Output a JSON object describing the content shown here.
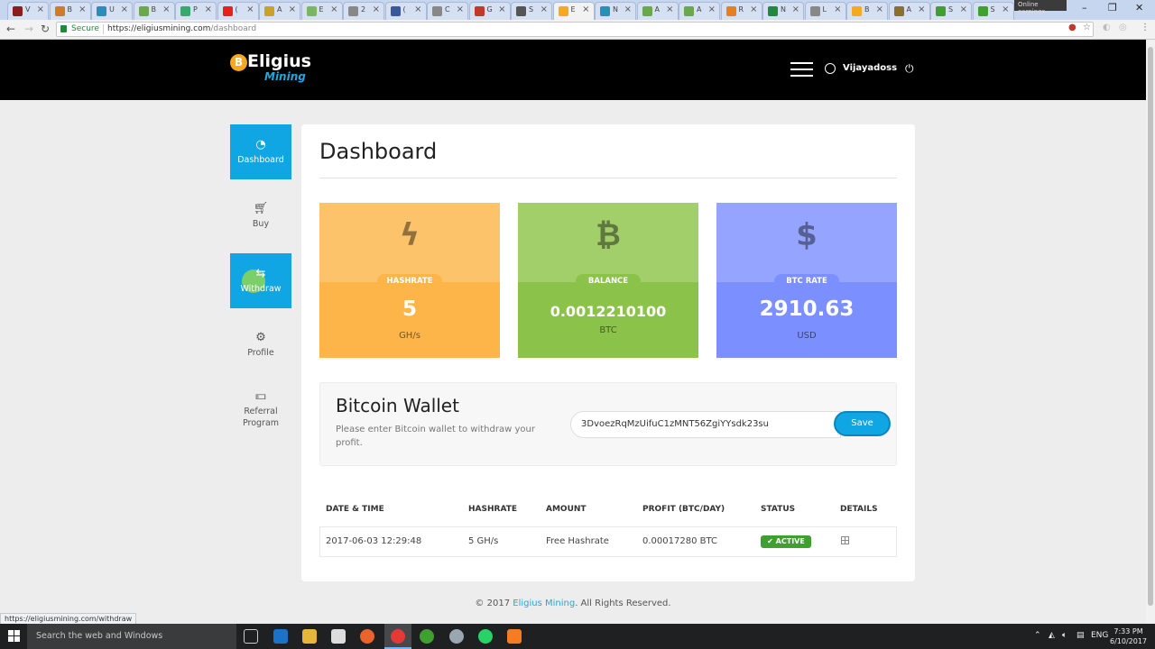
{
  "browser": {
    "tabs": [
      {
        "title": "V",
        "color": "#8b1d1d"
      },
      {
        "title": "B",
        "color": "#d07b2a"
      },
      {
        "title": "U",
        "color": "#2a8fb7"
      },
      {
        "title": "B",
        "color": "#6aa84f"
      },
      {
        "title": "P",
        "color": "#3aa76d"
      },
      {
        "title": "(",
        "color": "#e62117"
      },
      {
        "title": "A",
        "color": "#c9a227"
      },
      {
        "title": "E",
        "color": "#7bb661"
      },
      {
        "title": "2",
        "color": "#888888"
      },
      {
        "title": "(",
        "color": "#3b5998"
      },
      {
        "title": "C",
        "color": "#888888"
      },
      {
        "title": "G",
        "color": "#c0392b"
      },
      {
        "title": "S",
        "color": "#555555"
      },
      {
        "title": "E",
        "color": "#f6a821"
      },
      {
        "title": "N",
        "color": "#2a8fb7"
      },
      {
        "title": "A",
        "color": "#6aa84f"
      },
      {
        "title": "A",
        "color": "#6aa84f"
      },
      {
        "title": "R",
        "color": "#e67e22"
      },
      {
        "title": "N",
        "color": "#1e8a3c"
      },
      {
        "title": "L",
        "color": "#888888"
      },
      {
        "title": "B",
        "color": "#f6a821"
      },
      {
        "title": "A",
        "color": "#8b6f2f"
      },
      {
        "title": "S",
        "color": "#3fa02f"
      },
      {
        "title": "S",
        "color": "#3fa02f"
      }
    ],
    "profile_label": "Online earnings",
    "secure_label": "Secure",
    "url_base": "https://eligiusmining.com",
    "url_path": "/dashboard",
    "status_url": "https://eligiusmining.com/withdraw"
  },
  "header": {
    "logo_coin": "B",
    "logo_main": "Eligius",
    "logo_sub": "Mining",
    "username": "Vijayadoss"
  },
  "sidebar": {
    "items": [
      {
        "label": "Dashboard",
        "icon": "dashboard-icon"
      },
      {
        "label": "Buy",
        "icon": "cart-icon"
      },
      {
        "label": "Withdraw",
        "icon": "withdraw-icon"
      },
      {
        "label": "Profile",
        "icon": "gear-icon"
      },
      {
        "label": "Referral Program",
        "icon": "money-icon"
      }
    ]
  },
  "main": {
    "title": "Dashboard",
    "stats": [
      {
        "label": "HASHRATE",
        "value": "5",
        "unit": "GH/s",
        "icon": "bolt-icon",
        "top_color": "#fcc36b",
        "bottom_color": "#fdb54a",
        "pill_color": "#fdb54a"
      },
      {
        "label": "BALANCE",
        "value": "0.0012210100",
        "unit": "BTC",
        "icon": "bitcoin-icon",
        "top_color": "#a3cf6b",
        "bottom_color": "#8bc34a",
        "pill_color": "#8bc34a"
      },
      {
        "label": "BTC RATE",
        "value": "2910.63",
        "unit": "USD",
        "icon": "dollar-icon",
        "top_color": "#95a5ff",
        "bottom_color": "#7c8fff",
        "pill_color": "#7c8fff"
      }
    ],
    "wallet": {
      "title": "Bitcoin Wallet",
      "description": "Please enter Bitcoin wallet to withdraw your profit.",
      "address": "3DvoezRqMzUifuC1zMNT56ZgiYYsdk23su",
      "save_label": "Save"
    },
    "table": {
      "headers": [
        "DATE & TIME",
        "HASHRATE",
        "AMOUNT",
        "PROFIT (BTC/DAY)",
        "STATUS",
        "DETAILS"
      ],
      "rows": [
        {
          "date": "2017-06-03 12:29:48",
          "hashrate": "5 GH/s",
          "amount": "Free Hashrate",
          "profit": "0.00017280 BTC",
          "status": "ACTIVE"
        }
      ]
    }
  },
  "footer": {
    "prefix": "© 2017",
    "brand": "Eligius Mining",
    "suffix": ". All Rights Reserved."
  },
  "taskbar": {
    "search_placeholder": "Search the web and Windows",
    "language": "ENG",
    "time": "7:33 PM",
    "date": "6/10/2017"
  }
}
